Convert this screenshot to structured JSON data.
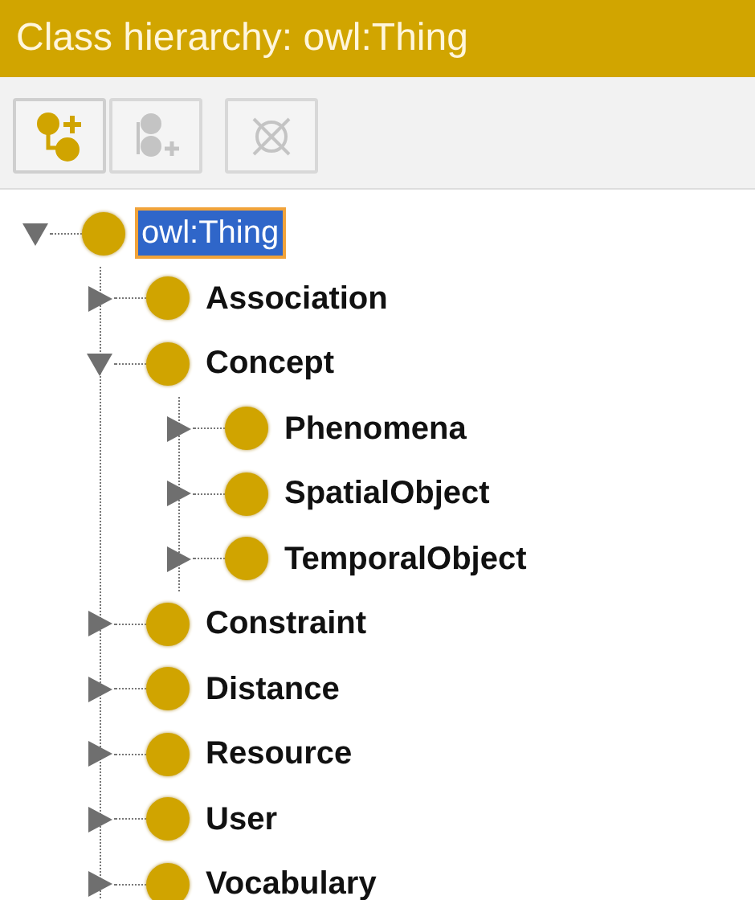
{
  "window": {
    "title": "Class hierarchy: owl:Thing"
  },
  "toolbar": [
    {
      "kind": "add-subclass",
      "disabled": false
    },
    {
      "kind": "add-sibling",
      "disabled": true
    },
    {
      "kind": "delete",
      "disabled": true
    }
  ],
  "tree": [
    {
      "label": "owl:Thing",
      "selected": true,
      "expanded": true,
      "children": [
        {
          "label": "Association",
          "selected": false,
          "expanded": false
        },
        {
          "label": "Concept",
          "selected": false,
          "expanded": true,
          "children": [
            {
              "label": "Phenomena",
              "selected": false,
              "expanded": false
            },
            {
              "label": "SpatialObject",
              "selected": false,
              "expanded": false
            },
            {
              "label": "TemporalObject",
              "selected": false,
              "expanded": false
            }
          ]
        },
        {
          "label": "Constraint",
          "selected": false,
          "expanded": false
        },
        {
          "label": "Distance",
          "selected": false,
          "expanded": false
        },
        {
          "label": "Resource",
          "selected": false,
          "expanded": false
        },
        {
          "label": "User",
          "selected": false,
          "expanded": false
        },
        {
          "label": "Vocabulary",
          "selected": false,
          "expanded": false
        }
      ]
    }
  ]
}
